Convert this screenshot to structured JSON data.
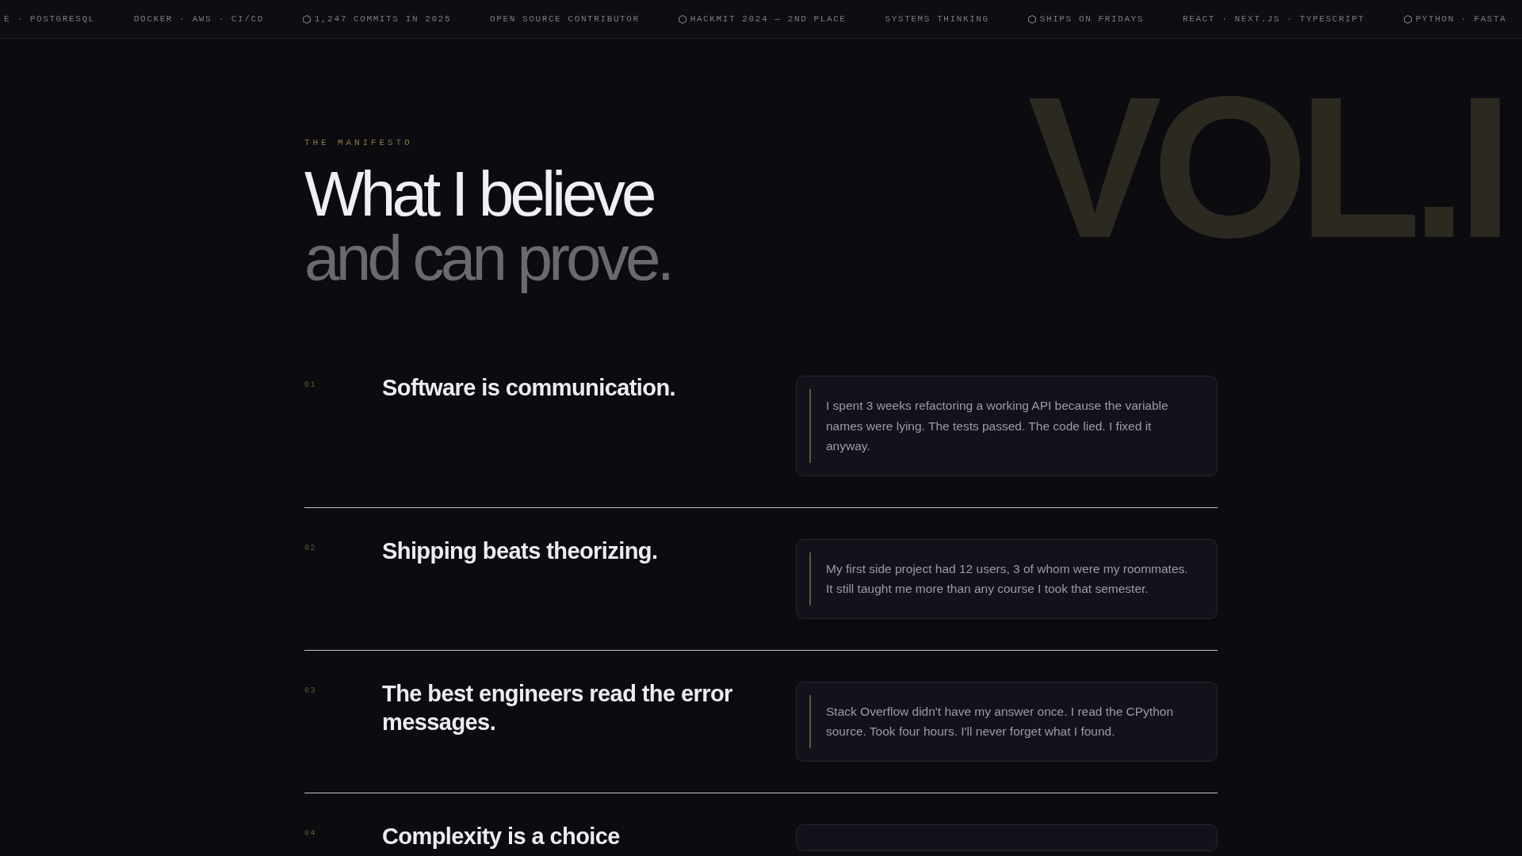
{
  "ticker": [
    {
      "kind": "plain",
      "text": "E · POSTGRESQL"
    },
    {
      "kind": "plain",
      "text": "DOCKER · AWS · CI/CD"
    },
    {
      "kind": "hex",
      "text": "1,247 COMMITS IN 2025"
    },
    {
      "kind": "plain",
      "text": "OPEN SOURCE CONTRIBUTOR"
    },
    {
      "kind": "hex",
      "text": "HACKMIT 2024 — 2ND PLACE"
    },
    {
      "kind": "plain",
      "text": "SYSTEMS THINKING"
    },
    {
      "kind": "hex",
      "text": "SHIPS ON FRIDAYS"
    },
    {
      "kind": "plain",
      "text": "REACT · NEXT.JS · TYPESCRIPT"
    },
    {
      "kind": "hex",
      "text": "PYTHON · FASTA"
    }
  ],
  "header": {
    "eyebrow": "THE MANIFESTO",
    "title_line_1": "What I believe",
    "title_line_2": "and can prove.",
    "backdrop_text": "VOL.I"
  },
  "beliefs": [
    {
      "number": "01",
      "title": "Software is communication.",
      "quote": "I spent 3 weeks refactoring a working API because the variable names were lying. The tests passed. The code lied. I fixed it anyway."
    },
    {
      "number": "02",
      "title": "Shipping beats theorizing.",
      "quote": "My first side project had 12 users, 3 of whom were my roommates. It still taught me more than any course I took that semester."
    },
    {
      "number": "03",
      "title": "The best engineers read the error messages.",
      "quote": "Stack Overflow didn't have my answer once. I read the CPython source. Took four hours. I'll never forget what I found."
    },
    {
      "number": "04",
      "title": "Complexity is a choice"
    }
  ]
}
